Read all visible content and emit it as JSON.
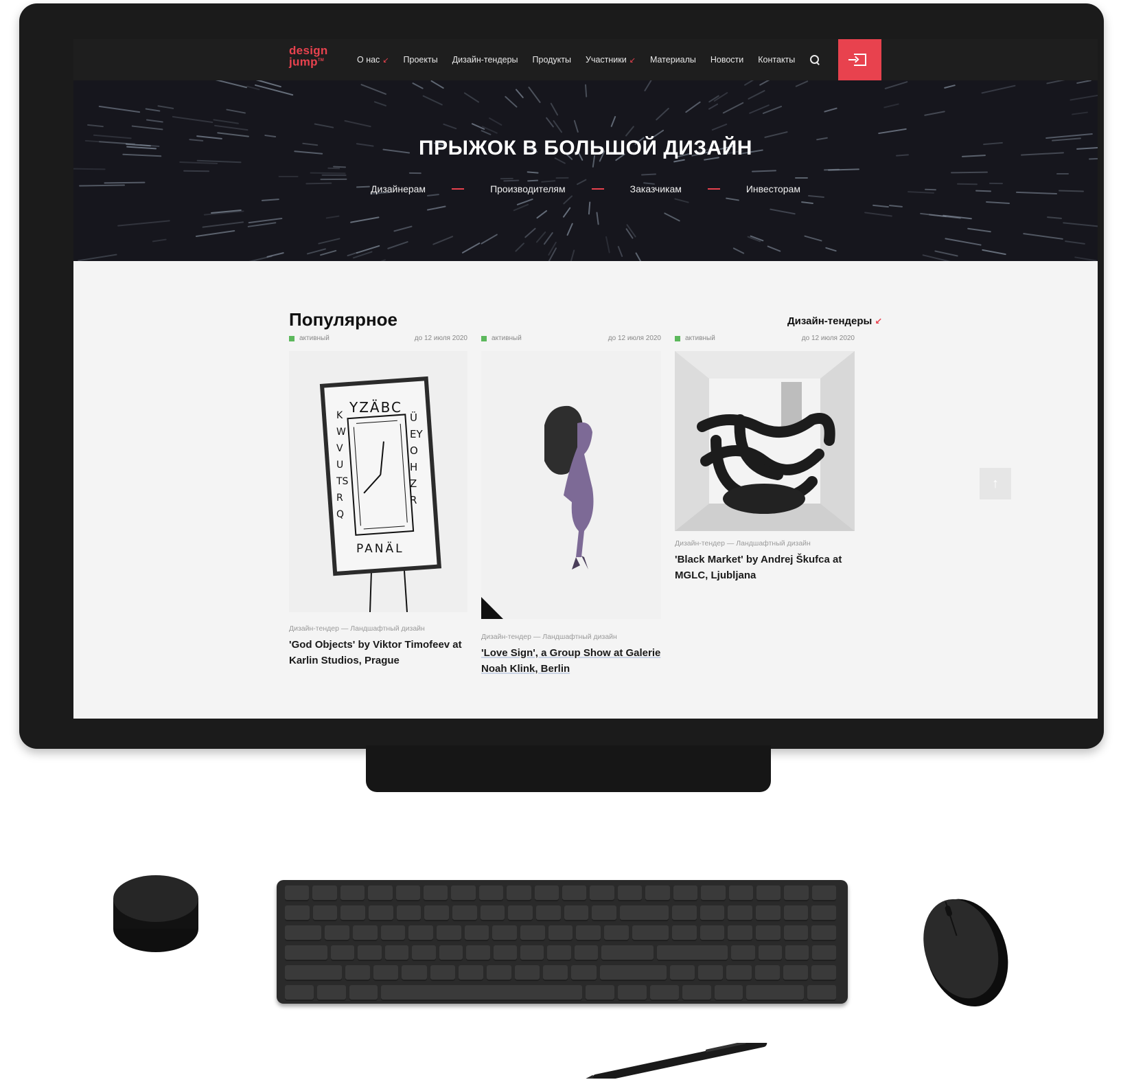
{
  "site": {
    "logo_line1": "design",
    "logo_line2": "jump",
    "logo_tm": "TM"
  },
  "nav": {
    "items": [
      {
        "label": "О нас",
        "has_arrow": true
      },
      {
        "label": "Проекты",
        "has_arrow": false
      },
      {
        "label": "Дизайн-тендеры",
        "has_arrow": false
      },
      {
        "label": "Продукты",
        "has_arrow": false
      },
      {
        "label": "Участники",
        "has_arrow": true
      },
      {
        "label": "Материалы",
        "has_arrow": false
      },
      {
        "label": "Новости",
        "has_arrow": false
      },
      {
        "label": "Контакты",
        "has_arrow": false
      }
    ],
    "arrow_glyph": "↙",
    "search_icon": "search-icon",
    "login_icon": "login-icon"
  },
  "hero": {
    "title": "ПРЫЖОК В БОЛЬШОЙ ДИЗАЙН",
    "links": [
      "Дизайнерам",
      "Производителям",
      "Заказчикам",
      "Инвесторам"
    ]
  },
  "popular": {
    "title": "Популярное",
    "link_label": "Дизайн-тендеры",
    "link_arrow": "↙",
    "cards": [
      {
        "status": "активный",
        "date": "до 12 июля 2020",
        "category": "Дизайн-тендер — Ландшафтный дизайн",
        "title_line1": "'God Objects' by Viktor Timofeev at",
        "title_line2": "Karlin Studios, Prague"
      },
      {
        "status": "активный",
        "date": "до 12 июля 2020",
        "category": "Дизайн-тендер — Ландшафтный дизайн",
        "title_line1": "'Love Sign', a Group Show at Galerie",
        "title_line2": "Noah Klink, Berlin"
      },
      {
        "status": "активный",
        "date": "до 12 июля 2020",
        "category": "Дизайн-тендер — Ландшафтный дизайн",
        "title_line1": "'Black Market' by Andrej Škufca at",
        "title_line2": "MGLC, Ljubljana"
      }
    ],
    "clock_letters": {
      "top": "YZÄBC",
      "right": "ÜEYOHZR",
      "bottom": "PANÄL",
      "left": "KWVUTSRQ"
    }
  },
  "scroll_top_glyph": "↑",
  "colors": {
    "accent": "#e8424e",
    "status_active": "#5cb85c",
    "header_bg": "#1e1e1e",
    "hero_bg": "#16161d",
    "content_bg": "#f4f4f4"
  }
}
